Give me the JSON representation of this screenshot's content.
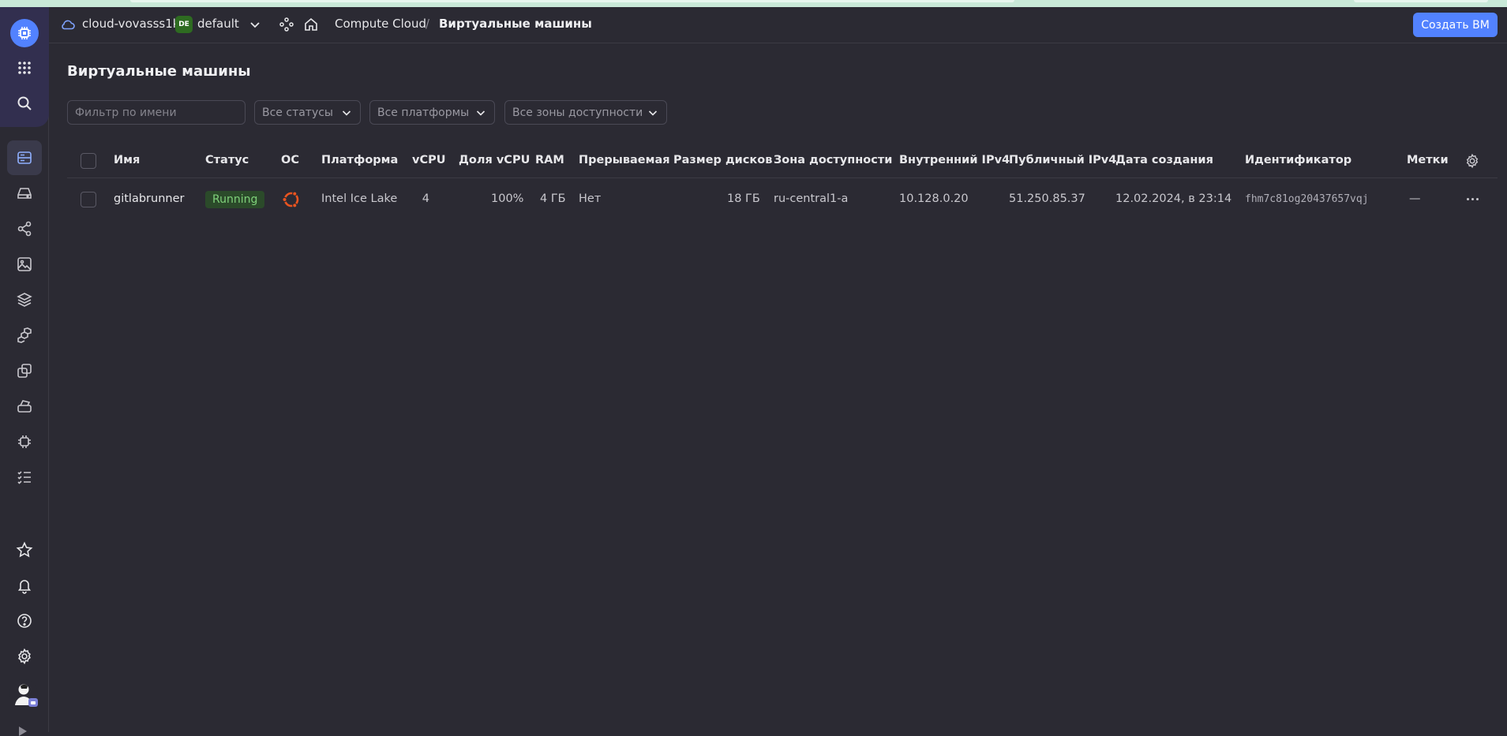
{
  "header": {
    "cloud_name": "cloud-vovasss1k",
    "folder_badge": "DE",
    "folder_name": "default",
    "breadcrumb_service": "Compute Cloud",
    "breadcrumb_separator": "/",
    "breadcrumb_current": "Виртуальные машины",
    "create_button": "Создать ВМ"
  },
  "page": {
    "title": "Виртуальные машины"
  },
  "filters": {
    "name_placeholder": "Фильтр по имени",
    "status_select": "Все статусы",
    "platform_select": "Все платформы",
    "zone_select": "Все зоны доступности"
  },
  "table": {
    "columns": {
      "name": "Имя",
      "status": "Статус",
      "os": "ОС",
      "platform": "Платформа",
      "vcpu": "vCPU",
      "vcpu_share": "Доля vCPU",
      "ram": "RAM",
      "preemptible": "Прерываемая",
      "disk_size": "Размер дисков",
      "zone": "Зона доступности",
      "internal_ipv4": "Внутренний IPv4",
      "public_ipv4": "Публичный IPv4",
      "created": "Дата создания",
      "id": "Идентификатор",
      "labels": "Метки"
    },
    "rows": [
      {
        "name": "gitlabrunner",
        "status": "Running",
        "os_icon": "ubuntu-icon",
        "platform": "Intel Ice Lake",
        "vcpu": "4",
        "vcpu_share": "100%",
        "ram": "4 ГБ",
        "preemptible": "Нет",
        "disk_size": "18 ГБ",
        "zone": "ru-central1-a",
        "internal_ipv4": "10.128.0.20",
        "public_ipv4": "51.250.85.37",
        "created": "12.02.2024, в 23:14",
        "id": "fhm7c81og20437657vqj",
        "labels": "—"
      }
    ]
  },
  "colors": {
    "accent": "#5282ff",
    "background": "#2b2a33",
    "status_running_bg": "#2b4a2a",
    "status_running_text": "#7fd17a",
    "ubuntu": "#e95420"
  }
}
